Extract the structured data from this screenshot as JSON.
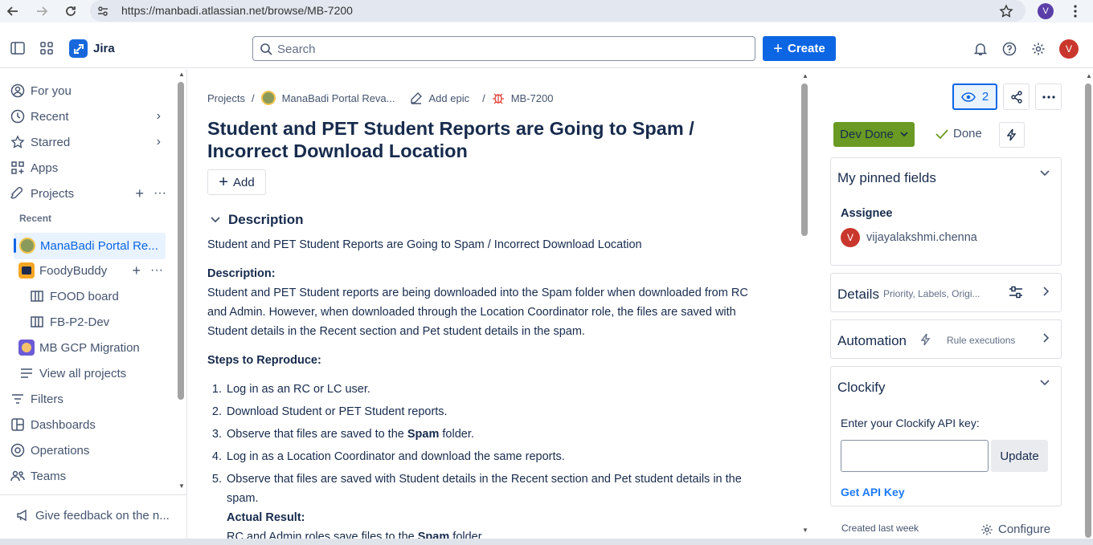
{
  "browser": {
    "url": "https://manbadi.atlassian.net/browse/MB-7200",
    "profile_initial": "V"
  },
  "topnav": {
    "app_name": "Jira",
    "search_placeholder": "Search",
    "create_label": "Create",
    "user_initial": "V"
  },
  "sidebar": {
    "items": [
      {
        "label": "For you"
      },
      {
        "label": "Recent"
      },
      {
        "label": "Starred"
      },
      {
        "label": "Apps"
      },
      {
        "label": "Projects"
      }
    ],
    "recent_header": "Recent",
    "projects": [
      {
        "label": "ManaBadi Portal Re..."
      },
      {
        "label": "FoodyBuddy"
      },
      {
        "label": "FOOD board"
      },
      {
        "label": "FB-P2-Dev"
      },
      {
        "label": "MB GCP Migration"
      },
      {
        "label": "View all projects"
      }
    ],
    "bottom_items": [
      {
        "label": "Filters"
      },
      {
        "label": "Dashboards"
      },
      {
        "label": "Operations"
      },
      {
        "label": "Teams"
      }
    ],
    "feedback": "Give feedback on the n..."
  },
  "breadcrumbs": {
    "projects": "Projects",
    "project": "ManaBadi Portal Reva...",
    "epic": "Add epic",
    "issue": "MB-7200",
    "sep": "/"
  },
  "issue": {
    "title": "Student and PET Student Reports are Going to Spam / Incorrect Download Location",
    "add_label": "Add",
    "description_header": "Description",
    "summary_line": "Student and PET Student Reports are Going to Spam / Incorrect Download Location",
    "desc_label": "Description:",
    "desc_text": "Student and PET Student reports are being downloaded into the Spam folder when downloaded from RC and Admin. However, when downloaded through the Location Coordinator role, the files are saved with Student details in the Recent section and Pet student details in the spam.",
    "steps_label": "Steps to Reproduce:",
    "steps": [
      {
        "n": "1.",
        "pre": "Log in as an RC or LC user.",
        "bold": "",
        "post": ""
      },
      {
        "n": "2.",
        "pre": "Download Student or PET Student reports.",
        "bold": "",
        "post": ""
      },
      {
        "n": "3.",
        "pre": "Observe that files are saved to the ",
        "bold": "Spam",
        "post": " folder."
      },
      {
        "n": "4.",
        "pre": "Log in as a Location Coordinator and download the same reports.",
        "bold": "",
        "post": ""
      },
      {
        "n": "5.",
        "pre": "Observe that files are saved with Student details in the Recent section and Pet student details in the spam.",
        "bold": "",
        "post": ""
      }
    ],
    "actual_label": "Actual Result:",
    "actual_pre": "RC and Admin roles save files to the ",
    "actual_bold": "Spam",
    "actual_post": " folder."
  },
  "right": {
    "watch_count": "2",
    "status": "Dev Done",
    "resolution": "Done",
    "pinned_title": "My pinned fields",
    "assignee_label": "Assignee",
    "assignee_initial": "V",
    "assignee_name": "vijayalakshmi.chenna",
    "details_title": "Details",
    "details_sub": "Priority, Labels, Origi...",
    "automation_title": "Automation",
    "automation_sub": "Rule executions",
    "clockify_title": "Clockify",
    "clockify_prompt": "Enter your Clockify API key:",
    "update_label": "Update",
    "api_link": "Get API Key",
    "created": "Created last week",
    "configure": "Configure"
  },
  "colors": {
    "accent": "#0c66e4",
    "status_green": "#6a9a23",
    "avatar_red": "#c9372c"
  }
}
